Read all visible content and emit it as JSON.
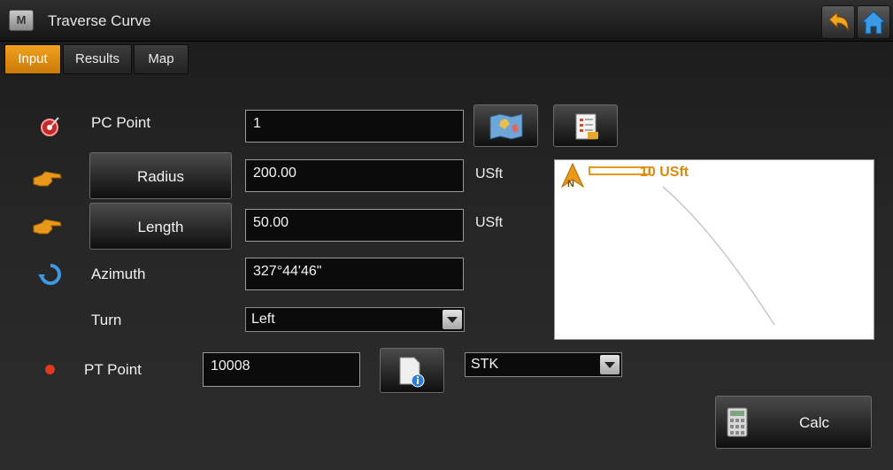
{
  "window": {
    "app_icon_letter": "M",
    "title": "Traverse Curve"
  },
  "tabs": [
    {
      "label": "Input"
    },
    {
      "label": "Results"
    },
    {
      "label": "Map"
    }
  ],
  "form": {
    "pc_point": {
      "label": "PC Point",
      "value": "1"
    },
    "radius": {
      "label": "Radius",
      "value": "200.00",
      "unit": "USft"
    },
    "length": {
      "label": "Length",
      "value": "50.00",
      "unit": "USft"
    },
    "azimuth": {
      "label": "Azimuth",
      "value": "327°44'46\""
    },
    "turn": {
      "label": "Turn",
      "value": "Left"
    },
    "pt_point": {
      "label": "PT Point",
      "value": "10008",
      "code": "STK"
    }
  },
  "preview": {
    "north_label": "N",
    "scale_text": "10 USft"
  },
  "actions": {
    "calc_label": "Calc"
  },
  "colors": {
    "accent": "#e8981a",
    "tab_active": "#f0a21e"
  }
}
